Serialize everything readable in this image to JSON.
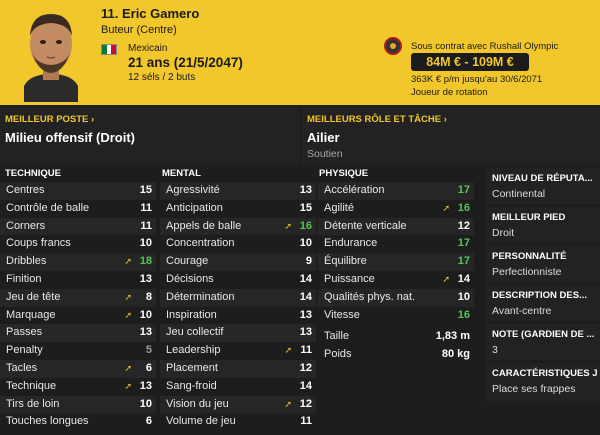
{
  "player": {
    "name": "11. Eric Gamero",
    "role": "Buteur (Centre)",
    "nationality": "Mexicain",
    "age": "21 ans (21/5/2047)",
    "caps": "12 séls / 2 buts"
  },
  "contract": {
    "status": "Sous contrat avec Rushall Olympic",
    "value": "84M € - 109M €",
    "wage": "363K € p/m jusqu'au 30/6/2071",
    "squad_status": "Joueur de rotation"
  },
  "best_position": {
    "label": "MEILLEUR POSTE",
    "value": "Milieu offensif (Droit)"
  },
  "best_role": {
    "label": "MEILLEURS RÔLE ET TÂCHE",
    "value": "Ailier",
    "duty": "Soutien"
  },
  "technique": {
    "title": "TECHNIQUE",
    "rows": [
      {
        "name": "Centres",
        "value": "15"
      },
      {
        "name": "Contrôle de balle",
        "value": "11"
      },
      {
        "name": "Corners",
        "value": "11"
      },
      {
        "name": "Coups francs",
        "value": "10"
      },
      {
        "name": "Dribbles",
        "value": "18"
      },
      {
        "name": "Finition",
        "value": "13"
      },
      {
        "name": "Jeu de tête",
        "value": "8"
      },
      {
        "name": "Marquage",
        "value": "10"
      },
      {
        "name": "Passes",
        "value": "13"
      },
      {
        "name": "Penalty",
        "value": "5"
      },
      {
        "name": "Tacles",
        "value": "6"
      },
      {
        "name": "Technique",
        "value": "13"
      },
      {
        "name": "Tirs de loin",
        "value": "10"
      },
      {
        "name": "Touches longues",
        "value": "6"
      }
    ]
  },
  "mental": {
    "title": "MENTAL",
    "rows": [
      {
        "name": "Agressivité",
        "value": "13"
      },
      {
        "name": "Anticipation",
        "value": "15"
      },
      {
        "name": "Appels de balle",
        "value": "16"
      },
      {
        "name": "Concentration",
        "value": "10"
      },
      {
        "name": "Courage",
        "value": "9"
      },
      {
        "name": "Décisions",
        "value": "14"
      },
      {
        "name": "Détermination",
        "value": "14"
      },
      {
        "name": "Inspiration",
        "value": "13"
      },
      {
        "name": "Jeu collectif",
        "value": "13"
      },
      {
        "name": "Leadership",
        "value": "11"
      },
      {
        "name": "Placement",
        "value": "12"
      },
      {
        "name": "Sang-froid",
        "value": "14"
      },
      {
        "name": "Vision du jeu",
        "value": "12"
      },
      {
        "name": "Volume de jeu",
        "value": "11"
      }
    ]
  },
  "physique": {
    "title": "PHYSIQUE",
    "rows": [
      {
        "name": "Accélération",
        "value": "17"
      },
      {
        "name": "Agilité",
        "value": "16"
      },
      {
        "name": "Détente verticale",
        "value": "12"
      },
      {
        "name": "Endurance",
        "value": "17"
      },
      {
        "name": "Équilibre",
        "value": "17"
      },
      {
        "name": "Puissance",
        "value": "14"
      },
      {
        "name": "Qualités phys. nat.",
        "value": "10"
      },
      {
        "name": "Vitesse",
        "value": "16"
      }
    ],
    "height_label": "Taille",
    "height": "1,83 m",
    "weight_label": "Poids",
    "weight": "80 kg"
  },
  "info": [
    {
      "key": "NIVEAU DE RÉPUTA...",
      "value": "Continental"
    },
    {
      "key": "MEILLEUR PIED",
      "value": "Droit"
    },
    {
      "key": "PERSONNALITÉ",
      "value": "Perfectionniste"
    },
    {
      "key": "DESCRIPTION DES...",
      "value": "Avant-centre"
    },
    {
      "key": "NOTE (GARDIEN DE ...",
      "value": "3"
    },
    {
      "key": "CARACTÉRISTIQUES J",
      "value": "Place ses frappes"
    }
  ],
  "colors": {
    "accent": "#f2c72b",
    "high_attribute": "#56c456",
    "background": "#1d1d1d"
  }
}
